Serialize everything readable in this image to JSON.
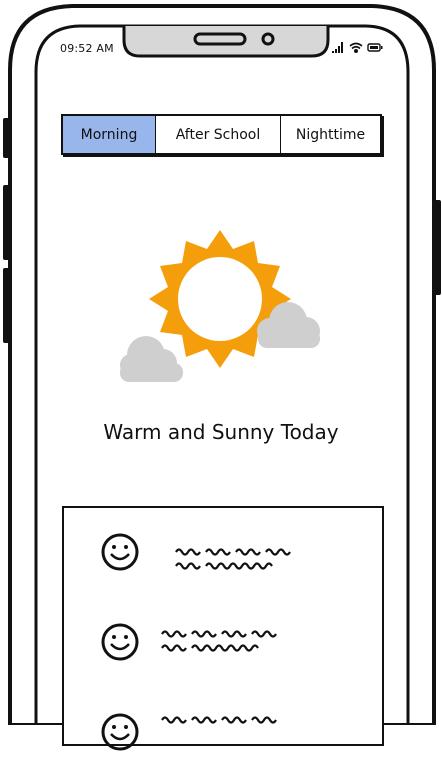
{
  "status_bar": {
    "time": "09:52 AM",
    "icons": [
      "signal-icon",
      "wifi-icon",
      "battery-icon"
    ]
  },
  "tabs": [
    {
      "label": "Morning",
      "active": true
    },
    {
      "label": "After School",
      "active": false
    },
    {
      "label": "Nighttime",
      "active": false
    }
  ],
  "weather": {
    "headline": "Warm and Sunny Today",
    "icon": "sun-with-clouds-icon"
  },
  "list": {
    "items": [
      {
        "icon": "smiley-icon"
      },
      {
        "icon": "smiley-icon"
      },
      {
        "icon": "smiley-icon"
      }
    ]
  },
  "colors": {
    "active_tab": "#98b6ec",
    "sun": "#f59e0b",
    "cloud": "#cfcfcf"
  }
}
